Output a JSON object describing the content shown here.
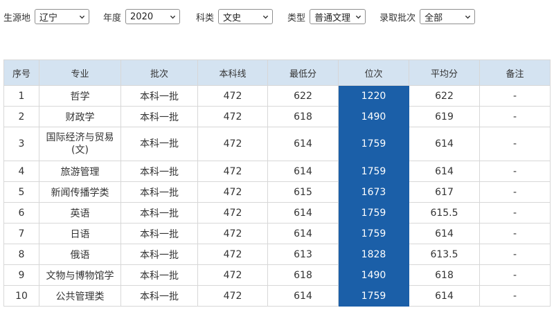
{
  "filters": {
    "province": {
      "label": "生源地",
      "value": "辽宁"
    },
    "year": {
      "label": "年度",
      "value": "2020"
    },
    "subject": {
      "label": "科类",
      "value": "文史"
    },
    "type": {
      "label": "类型",
      "value": "普通文理"
    },
    "batch": {
      "label": "录取批次",
      "value": "全部"
    }
  },
  "icons": {
    "dropdown": "chevron-down-icon"
  },
  "colors": {
    "header_bg": "#d4e3f1",
    "rank_bg": "#1b5fa8",
    "rank_text": "#ffffff"
  },
  "table": {
    "headers": [
      "序号",
      "专业",
      "批次",
      "本科线",
      "最低分",
      "位次",
      "平均分",
      "备注"
    ],
    "rows": [
      [
        "1",
        "哲学",
        "本科一批",
        "472",
        "622",
        "1220",
        "622",
        "-"
      ],
      [
        "2",
        "财政学",
        "本科一批",
        "472",
        "618",
        "1490",
        "619",
        "-"
      ],
      [
        "3",
        "国际经济与贸易(文)",
        "本科一批",
        "472",
        "614",
        "1759",
        "614",
        "-"
      ],
      [
        "4",
        "旅游管理",
        "本科一批",
        "472",
        "614",
        "1759",
        "614",
        "-"
      ],
      [
        "5",
        "新闻传播学类",
        "本科一批",
        "472",
        "615",
        "1673",
        "617",
        "-"
      ],
      [
        "6",
        "英语",
        "本科一批",
        "472",
        "614",
        "1759",
        "615.5",
        "-"
      ],
      [
        "7",
        "日语",
        "本科一批",
        "472",
        "614",
        "1759",
        "614",
        "-"
      ],
      [
        "8",
        "俄语",
        "本科一批",
        "472",
        "613",
        "1828",
        "613.5",
        "-"
      ],
      [
        "9",
        "文物与博物馆学",
        "本科一批",
        "472",
        "618",
        "1490",
        "618",
        "-"
      ],
      [
        "10",
        "公共管理类",
        "本科一批",
        "472",
        "614",
        "1759",
        "614",
        "-"
      ]
    ]
  }
}
